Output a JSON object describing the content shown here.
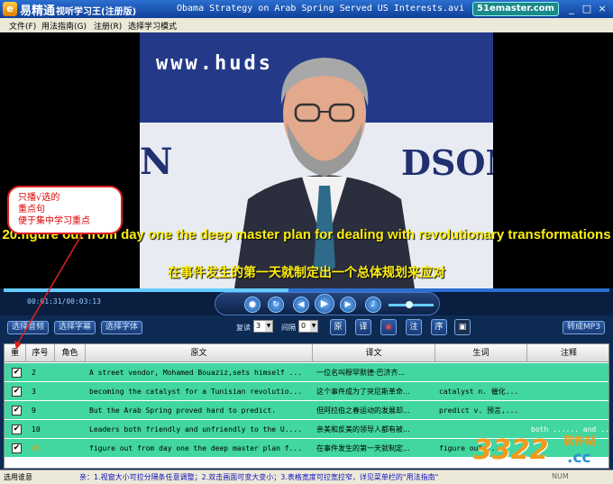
{
  "window": {
    "app_name": "易精通",
    "app_subtitle": "视听学习王(注册版)",
    "title": "Obama Strategy on Arab Spring Served US Interests.avi",
    "badge": "51emaster.com",
    "controls": [
      "_",
      "□",
      "×"
    ]
  },
  "menu": [
    "文件(F)",
    "用法指南(G)",
    "注册(R)",
    "选择学习模式"
  ],
  "video": {
    "backdrop_url_text": "www.huds",
    "backdrop_word_left": "N",
    "backdrop_word_right": "DSON",
    "subtitle_en": "20.figure out from day one the deep master plan for dealing with revolutionary transformations",
    "subtitle_zh": "在事件发生的第一天就制定出一个总体规划来应对"
  },
  "callout": {
    "lines": [
      "只播√选的",
      "重点句",
      "便于集中学习重点"
    ]
  },
  "player": {
    "time": "00:01:31/00:03:13",
    "progress": 0.47,
    "volume": 0.45,
    "icons": [
      "mic-icon",
      "repeat-icon",
      "prev-icon",
      "play-icon",
      "next-icon",
      "volume-icon"
    ]
  },
  "toolbar": {
    "select_audio": "选择音频",
    "select_subtitle": "选择字幕",
    "select_font": "选择字体",
    "repeat_label": "复读",
    "repeat_value": "3",
    "interval_label": "间隔",
    "interval_value": "0",
    "btn_original": "原",
    "btn_translation": "译",
    "btn_notes": "注",
    "btn_order": "序",
    "convert_mp3": "转成MP3"
  },
  "table": {
    "headers": [
      "重",
      "序号",
      "角色",
      "原文",
      "译文",
      "生词",
      "注释"
    ],
    "rows": [
      {
        "checked": true,
        "num": "2",
        "role": "",
        "original": "A street vendor, Mohamed Bouaziz,sets himself ...",
        "translation": "一位名叫穆罕默德·巴济齐...",
        "words": "",
        "notes": ""
      },
      {
        "checked": true,
        "num": "3",
        "role": "",
        "original": "becoming the catalyst for a Tunisian revolutio...",
        "translation": "这个事件成为了突尼斯革命...",
        "words": "catalyst n. 催化...",
        "notes": ""
      },
      {
        "checked": true,
        "num": "9",
        "role": "",
        "original": "But the Arab Spring proved hard to predict.",
        "translation": "但阿拉伯之春运动的发展却...",
        "words": "predict v. 预言,...",
        "notes": ""
      },
      {
        "checked": true,
        "num": "10",
        "role": "",
        "original": "Leaders both friendly and unfriendly to the U....",
        "translation": "亲美和反美的领导人都有被...",
        "words": "",
        "notes": "both ...... and ......"
      },
      {
        "checked": true,
        "num": "20",
        "role": "",
        "original": "figure out from day one the deep master plan f...",
        "translation": "在事件发生的第一天就制定...",
        "words": "figure out ...",
        "notes": ""
      }
    ]
  },
  "status": {
    "left": "选用谁意",
    "tip": "亲：1.视窗大小可拉分隔条任意调整；2.双击画面可变大变小；3.表格宽度可拉宽拉窄，详见菜单栏的\"用法指南\"",
    "right": "NUM"
  },
  "watermark": {
    "main": "3322",
    "small": "软件站",
    "tld": ".cc"
  }
}
